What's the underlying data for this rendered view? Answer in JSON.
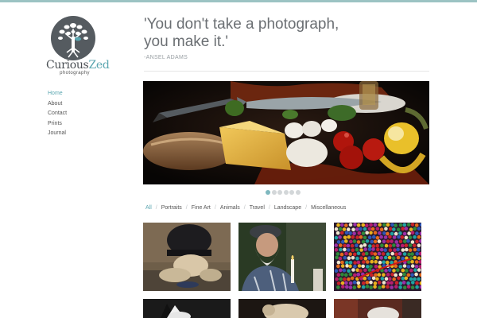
{
  "brand": {
    "name_part1": "Curious",
    "name_part2": "Zed",
    "subtitle": "photography"
  },
  "nav": {
    "items": [
      {
        "label": "Home",
        "active": true
      },
      {
        "label": "About",
        "active": false
      },
      {
        "label": "Contact",
        "active": false
      },
      {
        "label": "Prints",
        "active": false
      },
      {
        "label": "Journal",
        "active": false
      }
    ]
  },
  "quote": {
    "line1": "'You don't take a photograph,",
    "line2": "you make it.'",
    "author": "-ANSEL ADAMS"
  },
  "slider": {
    "slide_count": 6,
    "active_index": 0
  },
  "filters": {
    "items": [
      {
        "label": "All",
        "active": true
      },
      {
        "label": "Portraits",
        "active": false
      },
      {
        "label": "Fine Art",
        "active": false
      },
      {
        "label": "Animals",
        "active": false
      },
      {
        "label": "Travel",
        "active": false
      },
      {
        "label": "Landscape",
        "active": false
      },
      {
        "label": "Miscellaneous",
        "active": false
      }
    ]
  },
  "colors": {
    "accent": "#5aa6b0",
    "top_bar": "#9cc3c3",
    "text": "#555555",
    "quote_text": "#6b6f73"
  }
}
